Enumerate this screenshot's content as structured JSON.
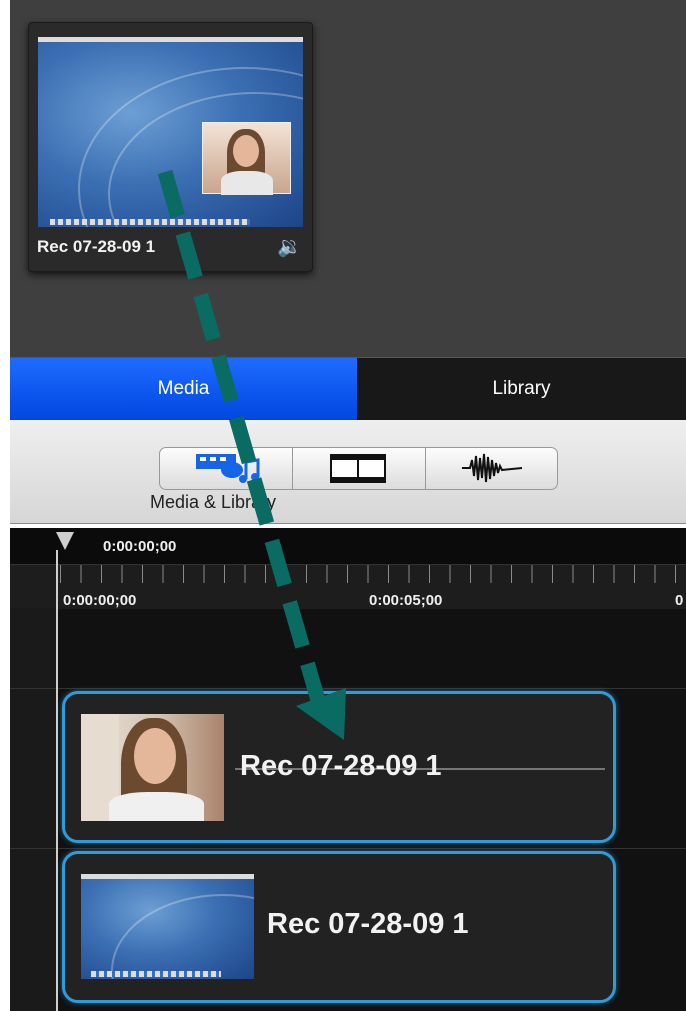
{
  "media_bin": {
    "clip_title": "Rec 07-28-09 1",
    "icons": {
      "thumbnail": "screen-recording-thumbnail",
      "audio": "speaker-icon"
    }
  },
  "tabs": {
    "media_label": "Media",
    "library_label": "Library"
  },
  "toolbar": {
    "active_label": "Media & Library",
    "buttons": [
      "media-library-icon",
      "film-strip-icon",
      "audio-waveform-icon"
    ]
  },
  "timeline": {
    "playhead_time": "0:00:00;00",
    "ruler_labels": [
      "0:00:00;00",
      "0:00:05;00",
      "0"
    ]
  },
  "tracks": [
    {
      "clip_title": "Rec 07-28-09 1",
      "thumbnail": "camera-thumbnail"
    },
    {
      "clip_title": "Rec 07-28-09 1",
      "thumbnail": "screen-thumbnail"
    }
  ],
  "colors": {
    "accent_blue": "#0047e0",
    "clip_border": "#2f9bd8",
    "arrow": "#0a6b63"
  }
}
